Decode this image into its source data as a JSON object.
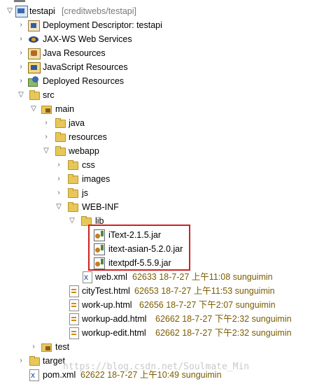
{
  "tree": {
    "project": {
      "label": "testapi",
      "meta": "[creditwebs/testapi]"
    },
    "items": [
      {
        "label": "Deployment Descriptor: testapi"
      },
      {
        "label": "JAX-WS Web Services"
      },
      {
        "label": "Java Resources"
      },
      {
        "label": "JavaScript Resources"
      },
      {
        "label": "Deployed Resources"
      },
      {
        "label": "src"
      },
      {
        "label": "main"
      },
      {
        "label": "java"
      },
      {
        "label": "resources"
      },
      {
        "label": "webapp"
      },
      {
        "label": "css"
      },
      {
        "label": "images"
      },
      {
        "label": "js"
      },
      {
        "label": "WEB-INF"
      },
      {
        "label": "lib"
      },
      {
        "label": "iText-2.1.5.jar"
      },
      {
        "label": "itext-asian-5.2.0.jar"
      },
      {
        "label": "itextpdf-5.5.9.jar"
      },
      {
        "label": "web.xml",
        "meta": "62633  18-7-27 上午11:08  sunguimin"
      },
      {
        "label": "cityTest.html",
        "meta": "62653  18-7-27 上午11:53  sunguimin"
      },
      {
        "label": "work-up.html",
        "meta": "62656  18-7-27 下午2:07  sunguimin"
      },
      {
        "label": "workup-add.html",
        "meta": "62662  18-7-27 下午2:32  sunguimin"
      },
      {
        "label": "workup-edit.html",
        "meta": "62662  18-7-27 下午2:32  sunguimin"
      },
      {
        "label": "test"
      },
      {
        "label": "target"
      },
      {
        "label": "pom.xml",
        "meta": "62622  18-7-27 上午10:49  sunguimin"
      }
    ]
  },
  "watermark": "https://blog.csdn.net/Soulmate_Min"
}
